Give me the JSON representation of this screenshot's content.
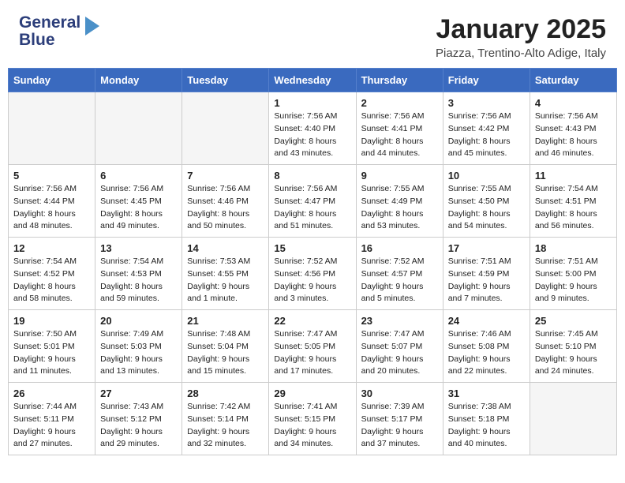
{
  "header": {
    "logo_line1": "General",
    "logo_line2": "Blue",
    "month": "January 2025",
    "location": "Piazza, Trentino-Alto Adige, Italy"
  },
  "days_of_week": [
    "Sunday",
    "Monday",
    "Tuesday",
    "Wednesday",
    "Thursday",
    "Friday",
    "Saturday"
  ],
  "weeks": [
    [
      {
        "day": "",
        "info": ""
      },
      {
        "day": "",
        "info": ""
      },
      {
        "day": "",
        "info": ""
      },
      {
        "day": "1",
        "info": "Sunrise: 7:56 AM\nSunset: 4:40 PM\nDaylight: 8 hours\nand 43 minutes."
      },
      {
        "day": "2",
        "info": "Sunrise: 7:56 AM\nSunset: 4:41 PM\nDaylight: 8 hours\nand 44 minutes."
      },
      {
        "day": "3",
        "info": "Sunrise: 7:56 AM\nSunset: 4:42 PM\nDaylight: 8 hours\nand 45 minutes."
      },
      {
        "day": "4",
        "info": "Sunrise: 7:56 AM\nSunset: 4:43 PM\nDaylight: 8 hours\nand 46 minutes."
      }
    ],
    [
      {
        "day": "5",
        "info": "Sunrise: 7:56 AM\nSunset: 4:44 PM\nDaylight: 8 hours\nand 48 minutes."
      },
      {
        "day": "6",
        "info": "Sunrise: 7:56 AM\nSunset: 4:45 PM\nDaylight: 8 hours\nand 49 minutes."
      },
      {
        "day": "7",
        "info": "Sunrise: 7:56 AM\nSunset: 4:46 PM\nDaylight: 8 hours\nand 50 minutes."
      },
      {
        "day": "8",
        "info": "Sunrise: 7:56 AM\nSunset: 4:47 PM\nDaylight: 8 hours\nand 51 minutes."
      },
      {
        "day": "9",
        "info": "Sunrise: 7:55 AM\nSunset: 4:49 PM\nDaylight: 8 hours\nand 53 minutes."
      },
      {
        "day": "10",
        "info": "Sunrise: 7:55 AM\nSunset: 4:50 PM\nDaylight: 8 hours\nand 54 minutes."
      },
      {
        "day": "11",
        "info": "Sunrise: 7:54 AM\nSunset: 4:51 PM\nDaylight: 8 hours\nand 56 minutes."
      }
    ],
    [
      {
        "day": "12",
        "info": "Sunrise: 7:54 AM\nSunset: 4:52 PM\nDaylight: 8 hours\nand 58 minutes."
      },
      {
        "day": "13",
        "info": "Sunrise: 7:54 AM\nSunset: 4:53 PM\nDaylight: 8 hours\nand 59 minutes."
      },
      {
        "day": "14",
        "info": "Sunrise: 7:53 AM\nSunset: 4:55 PM\nDaylight: 9 hours\nand 1 minute."
      },
      {
        "day": "15",
        "info": "Sunrise: 7:52 AM\nSunset: 4:56 PM\nDaylight: 9 hours\nand 3 minutes."
      },
      {
        "day": "16",
        "info": "Sunrise: 7:52 AM\nSunset: 4:57 PM\nDaylight: 9 hours\nand 5 minutes."
      },
      {
        "day": "17",
        "info": "Sunrise: 7:51 AM\nSunset: 4:59 PM\nDaylight: 9 hours\nand 7 minutes."
      },
      {
        "day": "18",
        "info": "Sunrise: 7:51 AM\nSunset: 5:00 PM\nDaylight: 9 hours\nand 9 minutes."
      }
    ],
    [
      {
        "day": "19",
        "info": "Sunrise: 7:50 AM\nSunset: 5:01 PM\nDaylight: 9 hours\nand 11 minutes."
      },
      {
        "day": "20",
        "info": "Sunrise: 7:49 AM\nSunset: 5:03 PM\nDaylight: 9 hours\nand 13 minutes."
      },
      {
        "day": "21",
        "info": "Sunrise: 7:48 AM\nSunset: 5:04 PM\nDaylight: 9 hours\nand 15 minutes."
      },
      {
        "day": "22",
        "info": "Sunrise: 7:47 AM\nSunset: 5:05 PM\nDaylight: 9 hours\nand 17 minutes."
      },
      {
        "day": "23",
        "info": "Sunrise: 7:47 AM\nSunset: 5:07 PM\nDaylight: 9 hours\nand 20 minutes."
      },
      {
        "day": "24",
        "info": "Sunrise: 7:46 AM\nSunset: 5:08 PM\nDaylight: 9 hours\nand 22 minutes."
      },
      {
        "day": "25",
        "info": "Sunrise: 7:45 AM\nSunset: 5:10 PM\nDaylight: 9 hours\nand 24 minutes."
      }
    ],
    [
      {
        "day": "26",
        "info": "Sunrise: 7:44 AM\nSunset: 5:11 PM\nDaylight: 9 hours\nand 27 minutes."
      },
      {
        "day": "27",
        "info": "Sunrise: 7:43 AM\nSunset: 5:12 PM\nDaylight: 9 hours\nand 29 minutes."
      },
      {
        "day": "28",
        "info": "Sunrise: 7:42 AM\nSunset: 5:14 PM\nDaylight: 9 hours\nand 32 minutes."
      },
      {
        "day": "29",
        "info": "Sunrise: 7:41 AM\nSunset: 5:15 PM\nDaylight: 9 hours\nand 34 minutes."
      },
      {
        "day": "30",
        "info": "Sunrise: 7:39 AM\nSunset: 5:17 PM\nDaylight: 9 hours\nand 37 minutes."
      },
      {
        "day": "31",
        "info": "Sunrise: 7:38 AM\nSunset: 5:18 PM\nDaylight: 9 hours\nand 40 minutes."
      },
      {
        "day": "",
        "info": ""
      }
    ]
  ]
}
